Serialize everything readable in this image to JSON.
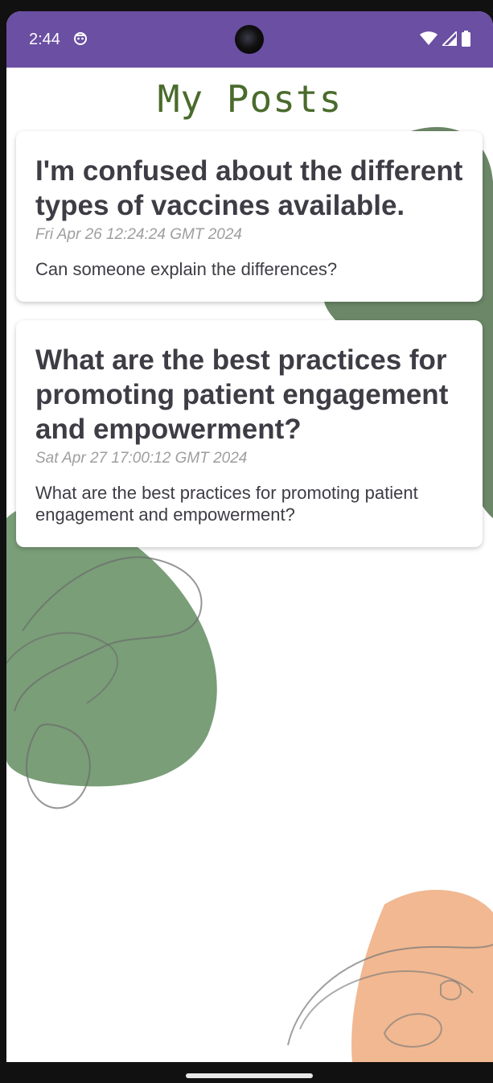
{
  "status_bar": {
    "time": "2:44",
    "icons": [
      "robot-icon",
      "wifi-icon",
      "cellular-signal-icon",
      "battery-icon"
    ],
    "background_color": "#6a4fa3"
  },
  "page": {
    "title": "My Posts",
    "title_color": "#4a6b2c"
  },
  "posts": [
    {
      "title": "I'm confused about the different types of vaccines available.",
      "date": "Fri Apr 26 12:24:24 GMT 2024",
      "body": "Can someone explain the differences?"
    },
    {
      "title": "What are the best practices for promoting patient engagement and empowerment?",
      "date": "Sat Apr 27 17:00:12 GMT 2024",
      "body": "What are the best practices for promoting patient engagement and empowerment?"
    }
  ],
  "decor_colors": {
    "green": "#7a9e78",
    "dark_green": "#5b7a56",
    "peach": "#f1b892"
  }
}
